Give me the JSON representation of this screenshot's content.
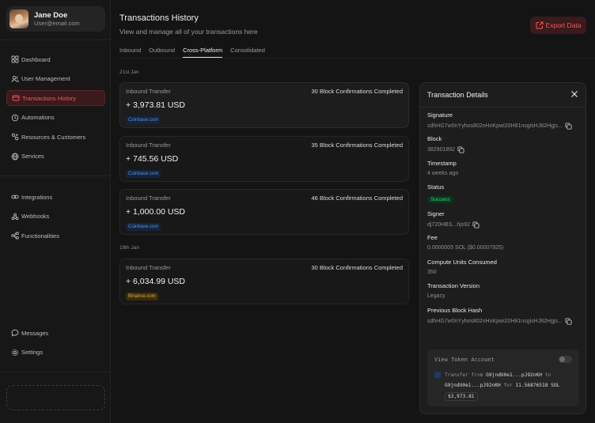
{
  "user": {
    "name": "Jane Doe",
    "email": "User@email.com"
  },
  "nav_main": [
    {
      "label": "Dashboard",
      "icon": "grid-icon"
    },
    {
      "label": "User Management",
      "icon": "users-icon"
    },
    {
      "label": "Transactions History",
      "icon": "card-icon",
      "active": true
    },
    {
      "label": "Automations",
      "icon": "automation-icon"
    },
    {
      "label": "Resources & Customers",
      "icon": "resources-icon"
    },
    {
      "label": "Services",
      "icon": "globe-icon"
    }
  ],
  "nav_secondary": [
    {
      "label": "Integrations",
      "icon": "link-icon"
    },
    {
      "label": "Webhooks",
      "icon": "webhook-icon"
    },
    {
      "label": "Functionalities",
      "icon": "flow-icon"
    }
  ],
  "nav_bottom": [
    {
      "label": "Messages",
      "icon": "chat-icon"
    },
    {
      "label": "Settings",
      "icon": "gear-icon"
    }
  ],
  "header": {
    "title": "Transactions History",
    "subtitle": "View and manage all of your transactions here",
    "export_label": "Export Data"
  },
  "tabs": [
    "Inbound",
    "Outbound",
    "Cross-Platform",
    "Consolidated"
  ],
  "active_tab": "Cross-Platform",
  "groups": [
    {
      "date": "21st Jan",
      "transactions": [
        {
          "type": "Inbound Transfer",
          "confirmations": "30 Block Confirmations Completed",
          "amount": "+ 3,973.81 USD",
          "source": "Coinbase.com"
        },
        {
          "type": "Inbound Transfer",
          "confirmations": "35 Block Confirmations Completed",
          "amount": "+ 745.56 USD",
          "source": "Coinbase.com"
        },
        {
          "type": "Inbound Transfer",
          "confirmations": "46 Block Confirmations Completed",
          "amount": "+ 1,000.00 USD",
          "source": "Coinbase.com"
        }
      ]
    },
    {
      "date": "19th Jan",
      "transactions": [
        {
          "type": "Inbound Transfer",
          "confirmations": "30 Block Confirmations Completed",
          "amount": "+ 6,034.99 USD",
          "source": "Binance.com"
        }
      ]
    }
  ],
  "details": {
    "title": "Transaction Details",
    "signature_label": "Signature",
    "signature": "sdhHG7w0nYyhos802nHnKpwi20H81nsgisHJ82Hgjs...",
    "block_label": "Block",
    "block": "382901892",
    "timestamp_label": "Timestamp",
    "timestamp": "4 weeks ago",
    "status_label": "Status",
    "status": "Success",
    "signer_label": "Signer",
    "signer": "dj720HBS...hjs92",
    "fee_label": "Fee",
    "fee": "0.0000005 SOL ($0.00007925)",
    "compute_label": "Compute Units Consumed",
    "compute": "350",
    "version_label": "Transaction Version",
    "version": "Legacy",
    "prev_hash_label": "Previous Block Hash",
    "prev_hash": "sdhHG7w0nYyhos802nHnKpwi20H81nsgisHJ82Hgjs...",
    "token_account_label": "View Token Account",
    "transfer": {
      "from_word": "Transfer from",
      "from": "G9jndU0e1...pJ92nKH",
      "to_word": "to",
      "to": "G9jndU0e1...pJ92nKH",
      "for_word": "for",
      "quantity": "11.56876518 SOL",
      "value": "$3,973.81"
    }
  },
  "colors": {
    "accent": "#ef5a5a",
    "success": "#3ed27a",
    "coinbase": "#5b8fd8",
    "binance": "#e0b040"
  }
}
